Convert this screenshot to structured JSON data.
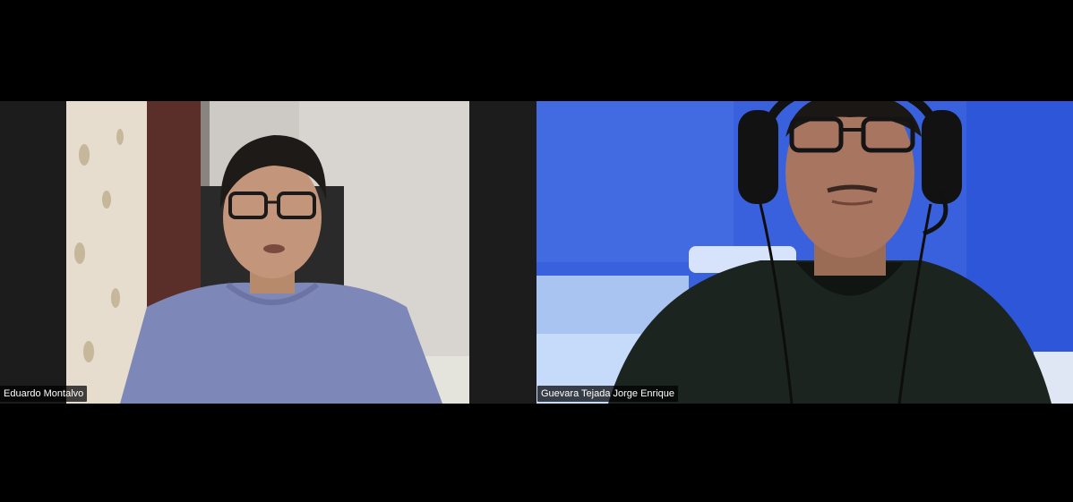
{
  "participants": [
    {
      "name": "Eduardo Montalvo",
      "video": "person-with-glasses-grey-tshirt"
    },
    {
      "name": "Guevara Tejada Jorge Enrique",
      "video": "person-with-headset-dark-tshirt"
    }
  ],
  "colors": {
    "background": "#000000",
    "tile_pad": "#1c1c1c",
    "name_label_bg": "rgba(0,0,0,0.72)",
    "name_label_text": "#ffffff"
  }
}
